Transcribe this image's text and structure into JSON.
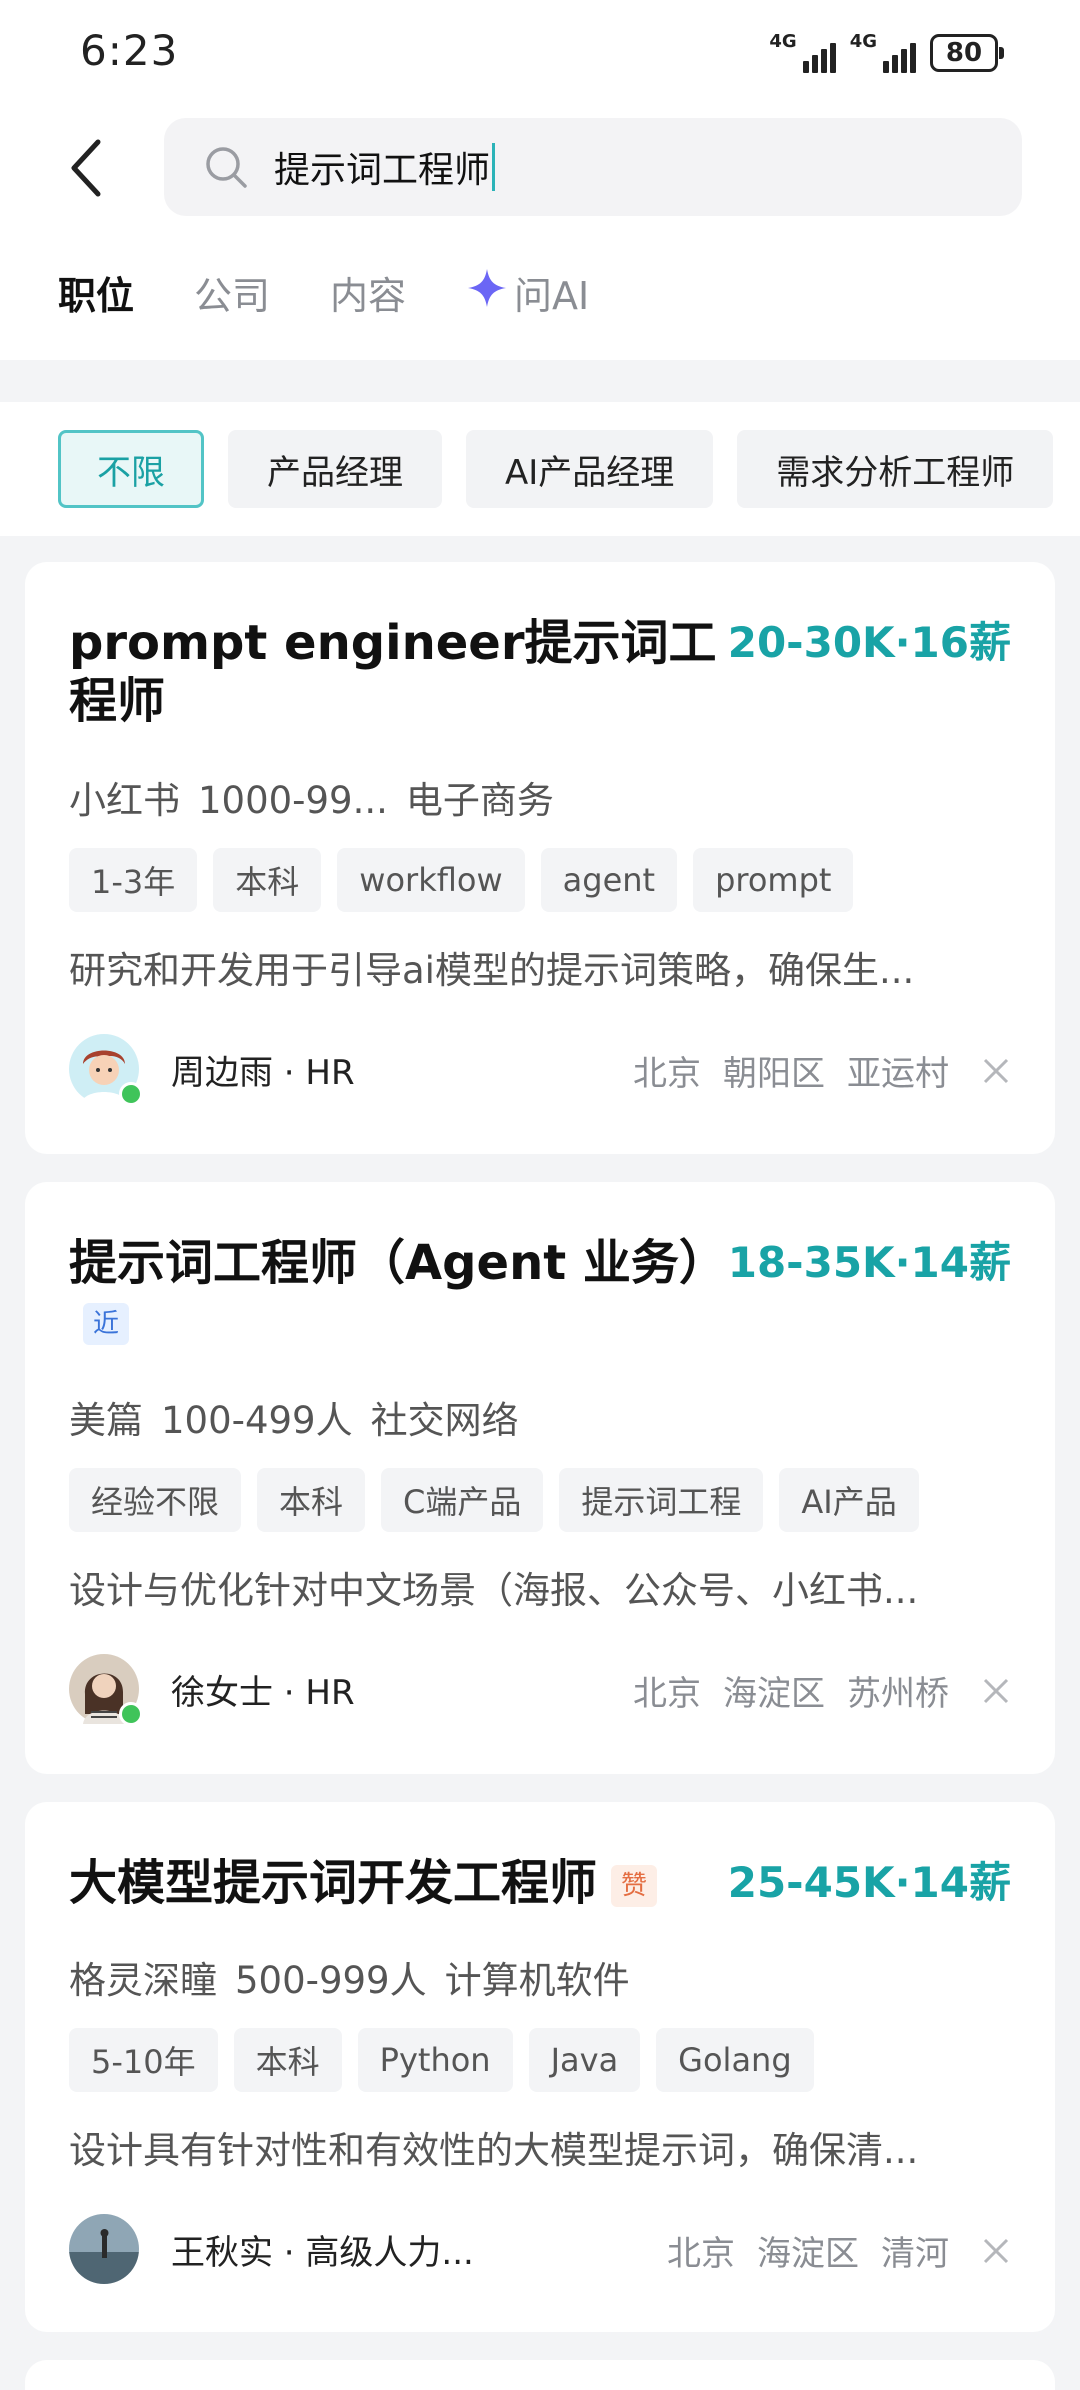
{
  "status": {
    "time": "6:23",
    "network1": "4G",
    "network2": "4G",
    "battery": "80"
  },
  "search": {
    "query": "提示词工程师"
  },
  "tabs": [
    {
      "label": "职位",
      "active": true
    },
    {
      "label": "公司",
      "active": false
    },
    {
      "label": "内容",
      "active": false
    },
    {
      "label": "问AI",
      "active": false
    }
  ],
  "filters": [
    {
      "label": "不限",
      "active": true
    },
    {
      "label": "产品经理",
      "active": false
    },
    {
      "label": "AI产品经理",
      "active": false
    },
    {
      "label": "需求分析工程师",
      "active": false
    }
  ],
  "jobs": [
    {
      "title": "prompt engineer提示词工程师",
      "badge": "",
      "salary": "20-30K·16薪",
      "company": "小红书",
      "size": "1000-99...",
      "industry": "电子商务",
      "tags": [
        "1-3年",
        "本科",
        "workflow",
        "agent",
        "prompt"
      ],
      "desc": "研究和开发用于引导ai模型的提示词策略，确保生...",
      "recruiter": "周边雨 · HR",
      "city": "北京",
      "district": "朝阳区",
      "area": "亚运村"
    },
    {
      "title": "提示词工程师（Agent 业务）",
      "badge": "近",
      "salary": "18-35K·14薪",
      "company": "美篇",
      "size": "100-499人",
      "industry": "社交网络",
      "tags": [
        "经验不限",
        "本科",
        "C端产品",
        "提示词工程",
        "AI产品"
      ],
      "desc": "设计与优化针对中文场景（海报、公众号、小红书...",
      "recruiter": "徐女士 · HR",
      "city": "北京",
      "district": "海淀区",
      "area": "苏州桥"
    },
    {
      "title": "大模型提示词开发工程师",
      "badge": "赞",
      "salary": "25-45K·14薪",
      "company": "格灵深瞳",
      "size": "500-999人",
      "industry": "计算机软件",
      "tags": [
        "5-10年",
        "本科",
        "Python",
        "Java",
        "Golang"
      ],
      "desc": "设计具有针对性和有效性的大模型提示词，确保清...",
      "recruiter": "王秋实 · 高级人力...",
      "city": "北京",
      "district": "海淀区",
      "area": "清河"
    }
  ],
  "colors": {
    "accent": "#19a3a6",
    "online": "#3fc45a",
    "ai_star": "#6b66f5"
  }
}
